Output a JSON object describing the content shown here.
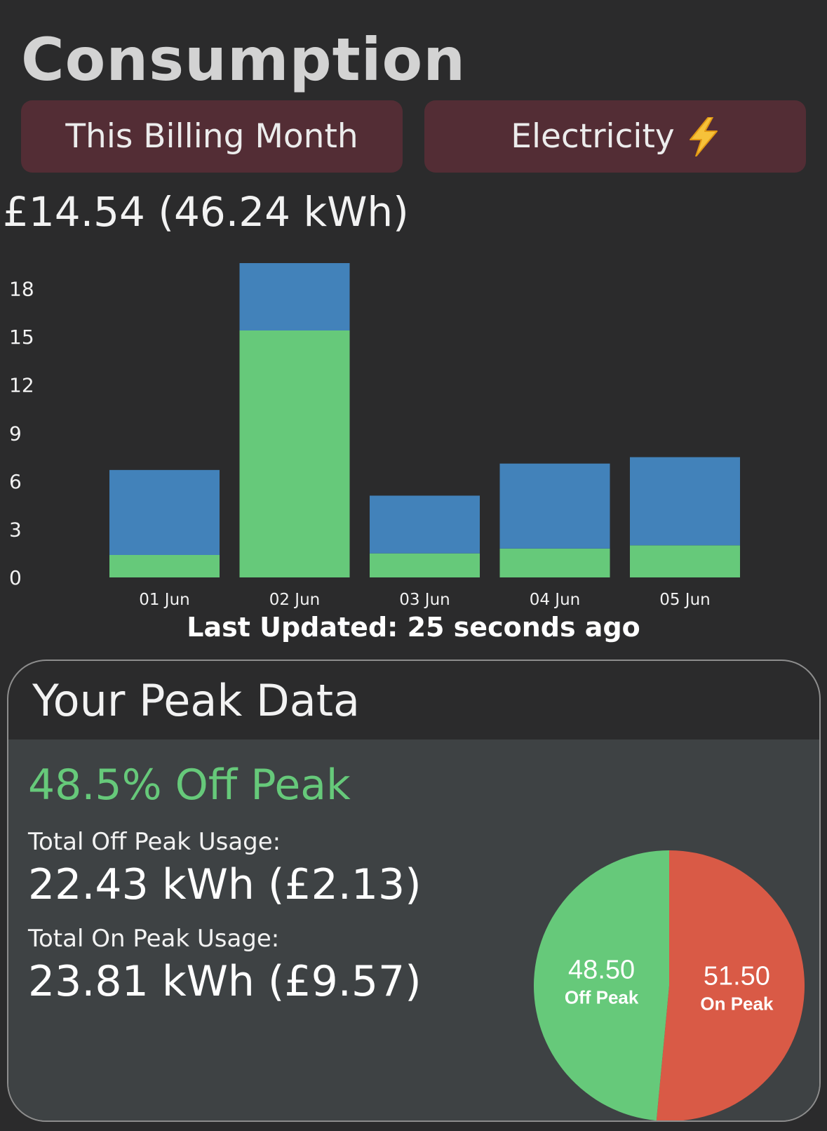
{
  "header": {
    "title": "Consumption"
  },
  "filters": {
    "period_label": "This Billing Month",
    "fuel_label": "Electricity",
    "fuel_icon": "lightning-bolt-icon"
  },
  "summary": {
    "text": "£14.54 (46.24 kWh)"
  },
  "chart_data": {
    "type": "bar",
    "stacked": true,
    "categories": [
      "01 Jun",
      "02 Jun",
      "03 Jun",
      "04 Jun",
      "05 Jun"
    ],
    "series": [
      {
        "values": [
          1.4,
          15.4,
          1.5,
          1.8,
          2.0
        ],
        "color": "#66c97a"
      },
      {
        "values": [
          5.3,
          4.2,
          3.6,
          5.3,
          5.5
        ],
        "color": "#4282ba"
      }
    ],
    "y_ticks": [
      0,
      3,
      6,
      9,
      12,
      15,
      18
    ],
    "ylim": [
      0,
      19.6
    ],
    "grid": false,
    "legend": "none"
  },
  "status": {
    "last_updated": "Last Updated: 25 seconds ago"
  },
  "peak": {
    "title": "Your Peak Data",
    "off_peak_percent": "48.5% Off Peak",
    "off_peak_label": "Total Off Peak Usage:",
    "off_peak_value": "22.43 kWh (£2.13)",
    "on_peak_label": "Total On Peak Usage:",
    "on_peak_value": "23.81 kWh (£9.57)",
    "colors": {
      "off_peak": "#66c97a",
      "on_peak": "#d95a46"
    },
    "pie": {
      "slices": [
        {
          "value": 48.5,
          "value_label": "48.50",
          "name": "Off Peak",
          "color": "#66c97a"
        },
        {
          "value": 51.5,
          "value_label": "51.50",
          "name": "On Peak",
          "color": "#d95a46"
        }
      ]
    }
  }
}
